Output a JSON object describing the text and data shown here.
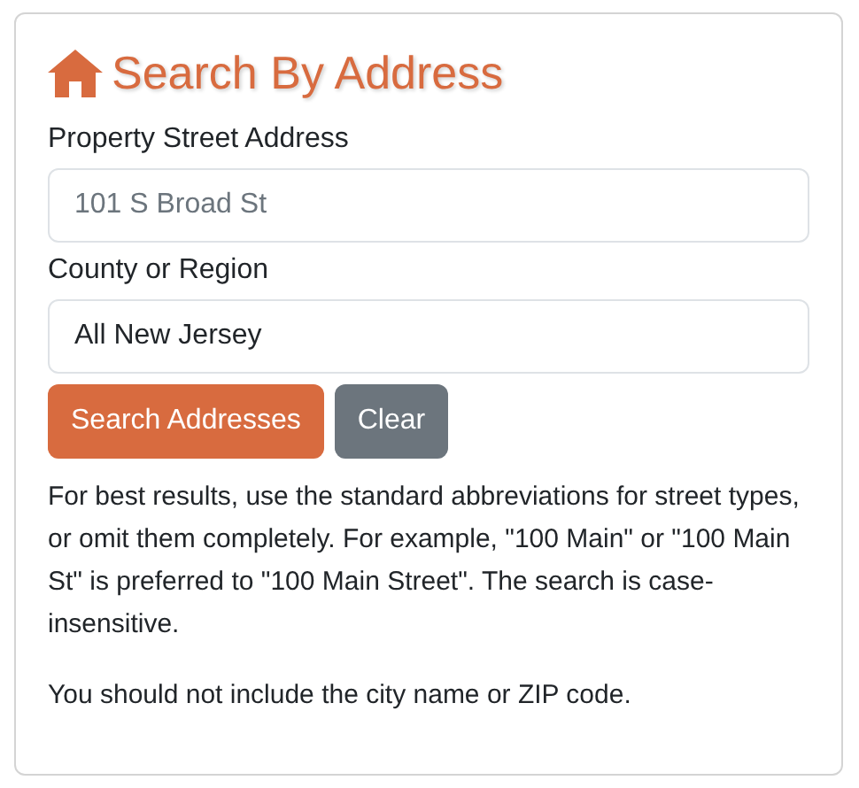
{
  "title": "Search By Address",
  "fields": [
    {
      "label": "Property Street Address",
      "placeholder": "101 S Broad St"
    },
    {
      "label": "County or Region",
      "value": "All New Jersey"
    }
  ],
  "buttons": [
    {
      "label": "Search Addresses",
      "kind": "primary"
    },
    {
      "label": "Clear",
      "kind": "secondary"
    }
  ],
  "notes": [
    "For best results, use the standard abbreviations for street types, or omit them completely. For example, \"100 Main\" or \"100 Main St\" is preferred to \"100 Main Street\". The search is case-insensitive.",
    "You should not include the city name or ZIP code."
  ]
}
